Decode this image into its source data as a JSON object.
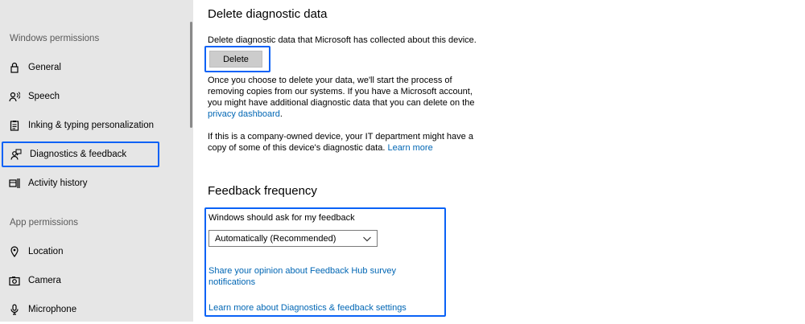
{
  "sidebar": {
    "windows_permissions_header": "Windows permissions",
    "app_permissions_header": "App permissions",
    "items": [
      {
        "label": "General",
        "icon": "lock-icon"
      },
      {
        "label": "Speech",
        "icon": "speech-icon"
      },
      {
        "label": "Inking & typing personalization",
        "icon": "clipboard-icon"
      },
      {
        "label": "Diagnostics & feedback",
        "icon": "feedback-person-icon",
        "selected": true
      },
      {
        "label": "Activity history",
        "icon": "timeline-icon"
      },
      {
        "label": "Location",
        "icon": "location-pin-icon"
      },
      {
        "label": "Camera",
        "icon": "camera-icon"
      },
      {
        "label": "Microphone",
        "icon": "microphone-icon"
      }
    ]
  },
  "delete_section": {
    "title": "Delete diagnostic data",
    "description": "Delete diagnostic data that Microsoft has collected about this device.",
    "button_label": "Delete",
    "info_text": "Once you choose to delete your data, we'll start the process of removing copies from our systems. If you have a Microsoft account, you might have additional diagnostic data that you can delete on the ",
    "privacy_link": "privacy dashboard",
    "info_suffix": ".",
    "company_text": "If this is a company-owned device, your IT department might have a copy of some of this device's diagnostic data. ",
    "learn_more_link": "Learn more"
  },
  "feedback_section": {
    "title": "Feedback frequency",
    "ask_label": "Windows should ask for my feedback",
    "selected_option": "Automatically (Recommended)",
    "share_link": "Share your opinion about Feedback Hub survey notifications",
    "learn_more_link": "Learn more about Diagnostics & feedback settings"
  },
  "colors": {
    "accent": "#0a62f6",
    "link": "#0066b4",
    "sidebar_bg": "#e6e6e6"
  }
}
